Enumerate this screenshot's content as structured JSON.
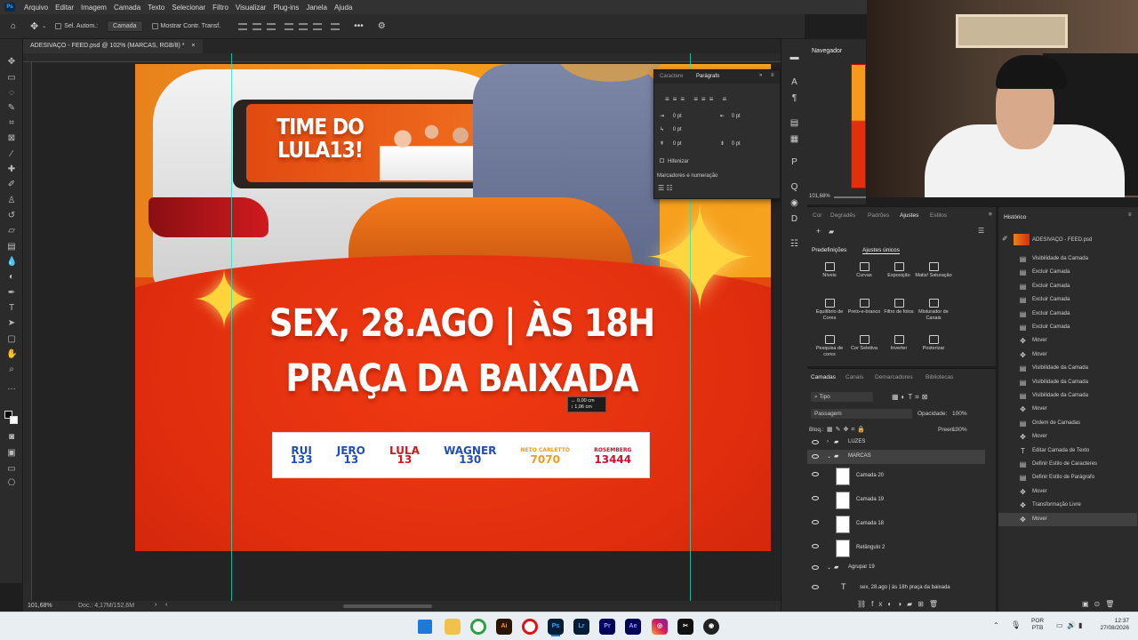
{
  "menu": [
    "Arquivo",
    "Editar",
    "Imagem",
    "Camada",
    "Texto",
    "Selecionar",
    "Filtro",
    "Visualizar",
    "Plug-ins",
    "Janela",
    "Ajuda"
  ],
  "options": {
    "auto_select_label": "Sel. Autom.:",
    "auto_select_value": "Camada",
    "show_transform_label": "Mostrar Contr. Transf."
  },
  "document": {
    "tab_title": "ADESIVAÇO - FEED.psd @ 102% (MARCAS, RGB/8) *",
    "zoom": "101,68%",
    "doc_size": "Doc.: 4,17M/152,6M",
    "measure_w": "0,00 cm",
    "measure_h": "1,06 cm"
  },
  "artwork": {
    "window_sign_line1": "TIME DO",
    "window_sign_line2": "LULA13!",
    "headline_line1": "SEX, 28.AGO | ÀS 18H",
    "headline_line2": "PRAÇA DA BAIXADA",
    "brands": [
      {
        "name": "RUI",
        "number": "133",
        "color": "#1e4fb4"
      },
      {
        "name": "JERO",
        "number": "13",
        "color": "#1e4fb4"
      },
      {
        "name": "LULA",
        "number": "13",
        "color": "#d2161c"
      },
      {
        "name": "WAGNER",
        "number": "130",
        "color": "#1e4fb4"
      },
      {
        "name": "NETO CARLETTO",
        "number": "7070",
        "color": "#f39a1e"
      },
      {
        "name": "ROSEMBERG",
        "number": "13444",
        "color": "#c8102e"
      }
    ]
  },
  "char_panel": {
    "tab_char": "Caractere",
    "tab_para": "Parágrafo",
    "fields": [
      "0 pt",
      "0 pt",
      "0 pt",
      "0 pt",
      "0 pt"
    ],
    "hyphenate": "Hifenizar",
    "bullets": "Marcadores e numeração"
  },
  "navigator": {
    "title": "Navegador",
    "zoom": "101,68%"
  },
  "adjustments": {
    "tabs": [
      "Cor",
      "Degradês",
      "Padrões",
      "Ajustes",
      "Estilos"
    ],
    "subtabs": [
      "Predefinições",
      "Ajustes únicos"
    ],
    "items": [
      "Níveis",
      "Curvas",
      "Exposição",
      "Matiz/ Saturação",
      "Equilíbrio de Cores",
      "Preto-e-branco",
      "Filtro de fotos",
      "Misturador de Canais",
      "Pesquisa de cores",
      "Cor Seletiva",
      "Inverter",
      "Posterizar"
    ]
  },
  "layers": {
    "tabs": [
      "Camadas",
      "Canais",
      "Demarcadores",
      "Bibliotecas"
    ],
    "kind": "Tipo",
    "blend": "Passagem",
    "opacity_label": "Opacidade:",
    "opacity": "100%",
    "lock_label": "Bloq.:",
    "fill_label": "Preen.:",
    "fill": "100%",
    "rows": [
      "LUZES",
      "MARCAS",
      "Camada 20",
      "Camada 19",
      "Camada 18",
      "Retângulo 2",
      "Agrupar 19",
      "sex, 28.ago | às 18h  praça da baixada"
    ]
  },
  "history": {
    "title": "Histórico",
    "snapshot": "ADESIVAÇO - FEED.psd",
    "items": [
      "Visibilidade da Camada",
      "Excluir Camada",
      "Excluir Camada",
      "Excluir Camada",
      "Excluir Camada",
      "Excluir Camada",
      "Mover",
      "Mover",
      "Visibilidade da Camada",
      "Visibilidade da Camada",
      "Visibilidade da Camada",
      "Mover",
      "Ordem de Camadas",
      "Mover",
      "Editar Camada de Texto",
      "Definir Estilo de Caracteres",
      "Definir Estilo de Parágrafo",
      "Mover",
      "Transformação Livre",
      "Mover"
    ]
  },
  "taskbar": {
    "lang_line1": "POR",
    "lang_line2": "PTB",
    "time": "12:37",
    "date": "27/08/2026"
  }
}
